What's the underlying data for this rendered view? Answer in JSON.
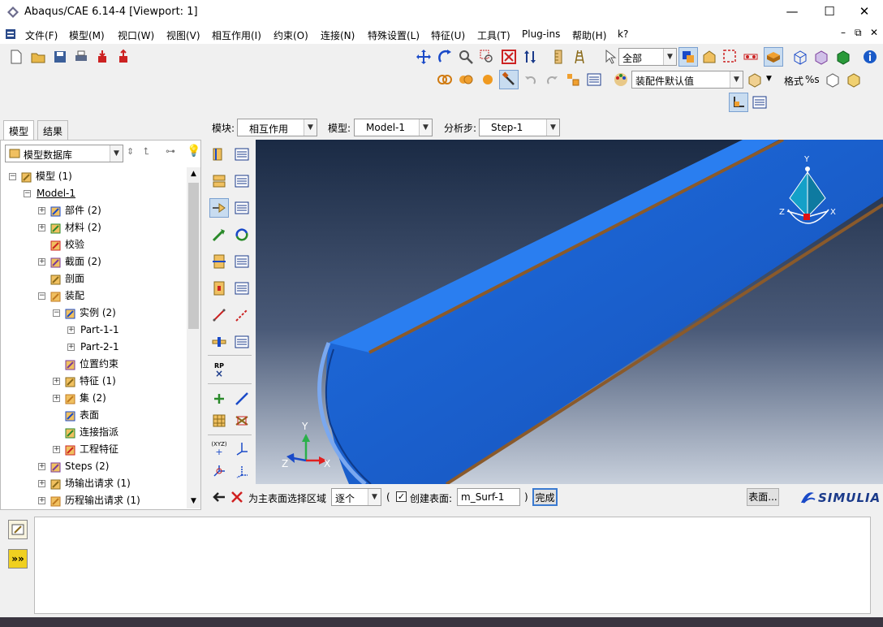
{
  "window": {
    "title": "Abaqus/CAE 6.14-4 [Viewport: 1]",
    "minimize": "—",
    "maximize": "☐",
    "close": "✕"
  },
  "menubar": {
    "items": [
      "文件(F)",
      "模型(M)",
      "视口(W)",
      "视图(V)",
      "相互作用(I)",
      "约束(O)",
      "连接(N)",
      "特殊设置(L)",
      "特征(U)",
      "工具(T)",
      "Plug-ins",
      "帮助(H)",
      "k?"
    ],
    "mdi_controls": [
      "–",
      "⧉",
      "✕"
    ]
  },
  "toolbar": {
    "selection_filter": "全部",
    "render_style": "装配件默认值",
    "format_label": "格式",
    "format_value": "%s"
  },
  "context": {
    "module_label": "模块:",
    "module_value": "相互作用",
    "model_label": "模型:",
    "model_value": "Model-1",
    "step_label": "分析步:",
    "step_value": "Step-1"
  },
  "left_tabs": [
    "模型",
    "结果"
  ],
  "tree_combo": "模型数据库",
  "tree": [
    {
      "label": "模型 (1)",
      "indent": 0,
      "pm": "-",
      "icon": "models-icon"
    },
    {
      "label": "Model-1",
      "indent": 1,
      "pm": "-",
      "icon": "",
      "underline": true
    },
    {
      "label": "部件 (2)",
      "indent": 2,
      "pm": "+",
      "icon": "parts-icon"
    },
    {
      "label": "材料 (2)",
      "indent": 2,
      "pm": "+",
      "icon": "materials-icon"
    },
    {
      "label": "校验",
      "indent": 2,
      "pm": "",
      "icon": "calibration-icon"
    },
    {
      "label": "截面 (2)",
      "indent": 2,
      "pm": "+",
      "icon": "sections-icon"
    },
    {
      "label": "剖面",
      "indent": 2,
      "pm": "",
      "icon": "profiles-icon"
    },
    {
      "label": "装配",
      "indent": 2,
      "pm": "-",
      "icon": "assembly-icon"
    },
    {
      "label": "实例 (2)",
      "indent": 3,
      "pm": "-",
      "icon": "instances-icon"
    },
    {
      "label": "Part-1-1",
      "indent": 4,
      "pm": "+",
      "icon": ""
    },
    {
      "label": "Part-2-1",
      "indent": 4,
      "pm": "+",
      "icon": ""
    },
    {
      "label": "位置约束",
      "indent": 3,
      "pm": "",
      "icon": "position-constraints-icon"
    },
    {
      "label": "特征 (1)",
      "indent": 3,
      "pm": "+",
      "icon": "features-icon"
    },
    {
      "label": "集 (2)",
      "indent": 3,
      "pm": "+",
      "icon": "sets-icon"
    },
    {
      "label": "表面",
      "indent": 3,
      "pm": "",
      "icon": "surfaces-icon"
    },
    {
      "label": "连接指派",
      "indent": 3,
      "pm": "",
      "icon": "connector-assignments-icon"
    },
    {
      "label": "工程特征",
      "indent": 3,
      "pm": "+",
      "icon": "engineering-features-icon"
    },
    {
      "label": "Steps (2)",
      "indent": 2,
      "pm": "+",
      "icon": "steps-icon"
    },
    {
      "label": "场输出请求 (1)",
      "indent": 2,
      "pm": "+",
      "icon": "field-output-icon"
    },
    {
      "label": "历程输出请求 (1)",
      "indent": 2,
      "pm": "+",
      "icon": "history-output-icon"
    }
  ],
  "viewport": {
    "triad_top": {
      "y": "Y",
      "x": "X",
      "z": "Z"
    },
    "triad_bottom": {
      "y": "Y",
      "x": "X",
      "z": "Z"
    },
    "rp_label": "RP",
    "xyz_label": "(XYZ)"
  },
  "prompt": {
    "text": "为主表面选择区域",
    "mode": "逐个",
    "paren_open": "(",
    "create_label": "创建表面:",
    "surface_name": "m_Surf-1",
    "paren_close": ")",
    "done": "完成",
    "surface_button": "表面...",
    "brand": "SIMULIA"
  },
  "colors": {
    "body_blue": "#1a64d6",
    "edge_brown": "#8a5a2b",
    "bg_top": "#1a2a44",
    "bg_bottom": "#c8d0dc"
  }
}
